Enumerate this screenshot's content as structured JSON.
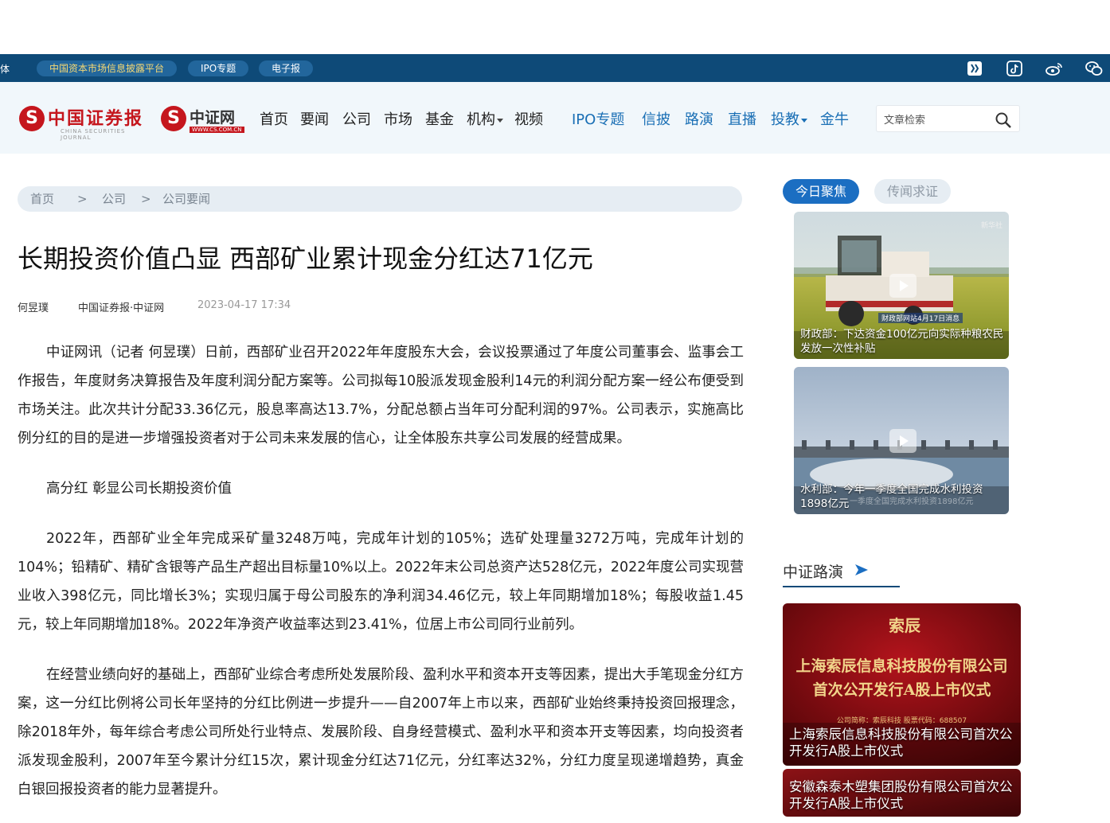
{
  "topbar": {
    "cut_label": "体",
    "links": [
      "中国资本市场信息披露平台",
      "IPO专题",
      "电子报"
    ],
    "icons": [
      "toutiao-icon",
      "douyin-icon",
      "weibo-icon",
      "wechat-icon"
    ]
  },
  "header": {
    "logo1_text": "中国证券报",
    "logo1_sub": "CHINA SECURITIES JOURNAL",
    "logo2_text": "中证网",
    "logo2_sub": "WWW.CS.COM.CN",
    "nav": [
      "首页",
      "要闻",
      "公司",
      "市场",
      "基金",
      "机构",
      "视频"
    ],
    "nav_special": [
      "IPO专题",
      "信披",
      "路演",
      "直播",
      "投教",
      "金牛"
    ],
    "search_placeholder": "文章检索"
  },
  "breadcrumb": [
    "首页",
    ">",
    "公司",
    ">",
    "公司要闻"
  ],
  "article": {
    "title": "长期投资价值凸显 西部矿业累计现金分红达71亿元",
    "author": "何昱璞",
    "source": "中国证券报·中证网",
    "date": "2023-04-17 17:34",
    "paragraphs": [
      "中证网讯（记者 何昱璞）日前，西部矿业召开2022年年度股东大会，会议投票通过了年度公司董事会、监事会工作报告，年度财务决算报告及年度利润分配方案等。公司拟每10股派发现金股利14元的利润分配方案一经公布便受到市场关注。此次共计分配33.36亿元，股息率高达13.7%，分配总额占当年可分配利润的97%。公司表示，实施高比例分红的目的是进一步增强投资者对于公司未来发展的信心，让全体股东共享公司发展的经营成果。",
      "高分红 彰显公司长期投资价值",
      "2022年，西部矿业全年完成采矿量3248万吨，完成年计划的105%；选矿处理量3272万吨，完成年计划的104%；铅精矿、精矿含银等产品生产超出目标量10%以上。2022年末公司总资产达528亿元，2022年度公司实现营业收入398亿元，同比增长3%；实现归属于母公司股东的净利润34.46亿元，较上年同期增加18%；每股收益1.45元，较上年同期增加18%。2022年净资产收益率达到23.41%，位居上市公司同行业前列。",
      "在经营业绩向好的基础上，西部矿业综合考虑所处发展阶段、盈利水平和资本开支等因素，提出大手笔现金分红方案，这一分红比例将公司长年坚持的分红比例进一步提升——自2007年上市以来，西部矿业始终秉持投资回报理念，除2018年外，每年综合考虑公司所处行业特点、发展阶段、自身经营模式、盈利水平和资本开支等因素，均向投资者派发现金股利，2007年至今累计分红15次，累计现金分红达71亿元，分红率达32%，分红力度呈现递增趋势，真金白银回报投资者的能力显著提升。"
    ]
  },
  "sidebar": {
    "tabs": [
      "今日聚焦",
      "传闻求证"
    ],
    "videos": [
      {
        "caption": "财政部：下达资金100亿元向实际种粮农民发放一次性补贴",
        "watermark": "新华社",
        "overlay": "财政部网站4月17日消息"
      },
      {
        "caption": "水利部：今年一季度全国完成水利投资1898亿元",
        "overlay": "一季度全国完成水利投资1898亿元"
      }
    ],
    "roadshow_title": "中证路演",
    "roadshow": [
      {
        "caption": "上海索辰信息科技股份有限公司首次公开发行A股上市仪式",
        "banner_line1": "上海索辰信息科技股份有限公司",
        "banner_line2": "首次公开发行A股上市仪式",
        "banner_code": "公司简称：索辰科技    股票代码：688507",
        "logo_mark": "索辰"
      },
      {
        "caption": "安徽森泰木塑集团股份有限公司首次公开发行A股上市仪式"
      }
    ]
  },
  "colors": {
    "topbar_bg": "#0e4a78",
    "header_bg": "#f1f7fb",
    "accent_blue": "#1b6ec2",
    "brand_red": "#c5161d"
  }
}
